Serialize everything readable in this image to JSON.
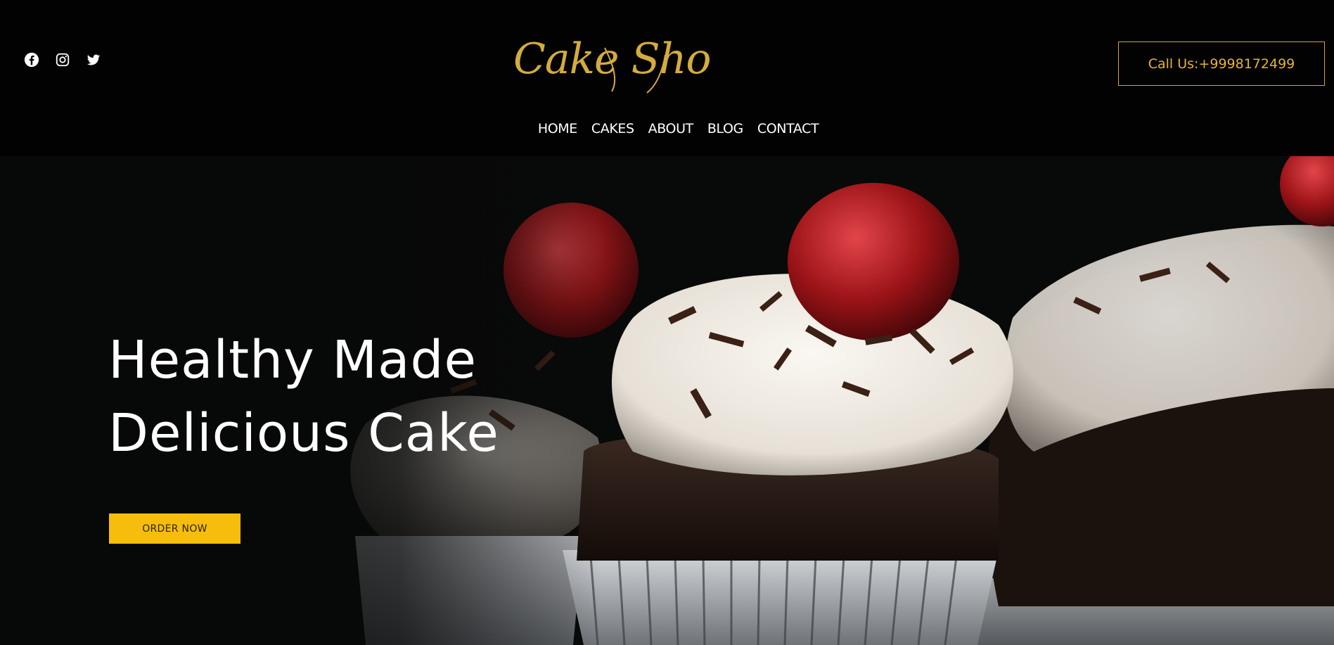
{
  "header": {
    "socials": [
      {
        "icon": "facebook-icon"
      },
      {
        "icon": "instagram-icon"
      },
      {
        "icon": "twitter-icon"
      }
    ],
    "logo_text": "Cake Shop",
    "call_label": "Call Us:+9998172499",
    "nav": [
      "HOME",
      "CAKES",
      "ABOUT",
      "BLOG",
      "CONTACT"
    ]
  },
  "hero": {
    "headline_line1": "Healthy Made",
    "headline_line2": "Delicious Cake",
    "cta_label": "ORDER NOW"
  },
  "colors": {
    "background": "#000000",
    "accent_gold": "#d8a626",
    "button_yellow": "#f6bd0c",
    "text_white": "#ffffff"
  }
}
